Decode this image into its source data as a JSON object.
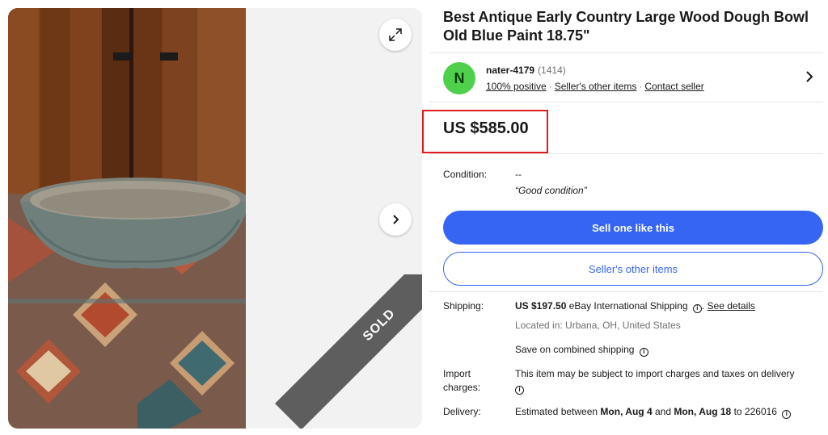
{
  "listing": {
    "title": "Best Antique Early Country Large Wood Dough Bowl Old Blue Paint 18.75\"",
    "price": "US $585.00",
    "sold_badge": "SOLD"
  },
  "seller": {
    "initial": "N",
    "name": "nater-4179",
    "feedback_count": "(1414)",
    "positive": "100% positive",
    "other_items": "Seller's other items",
    "contact": "Contact seller",
    "sep": "·",
    "avatar_color": "#4fd04c"
  },
  "condition": {
    "label": "Condition:",
    "value": "--",
    "note": "“Good condition”"
  },
  "buttons": {
    "sell_one": "Sell one like this",
    "sellers_other": "Seller's other items",
    "primary_color": "#3665f3"
  },
  "shipping": {
    "label": "Shipping:",
    "amount": "US $197.50",
    "method": "eBay International Shipping",
    "see_details": "See details",
    "period": ".",
    "location": "Located in: Urbana, OH, United States",
    "combined": "Save on combined shipping"
  },
  "import": {
    "label_line1": "Import",
    "label_line2": "charges:",
    "text": "This item may be subject to import charges and taxes on delivery"
  },
  "delivery": {
    "label": "Delivery:",
    "prefix": "Estimated between",
    "start": "Mon, Aug 4",
    "and": "and",
    "end": "Mon, Aug 18",
    "to": "to 226016"
  },
  "icons": {
    "expand": "expand-icon",
    "next": "chevron-right-icon",
    "info": "info-icon"
  }
}
